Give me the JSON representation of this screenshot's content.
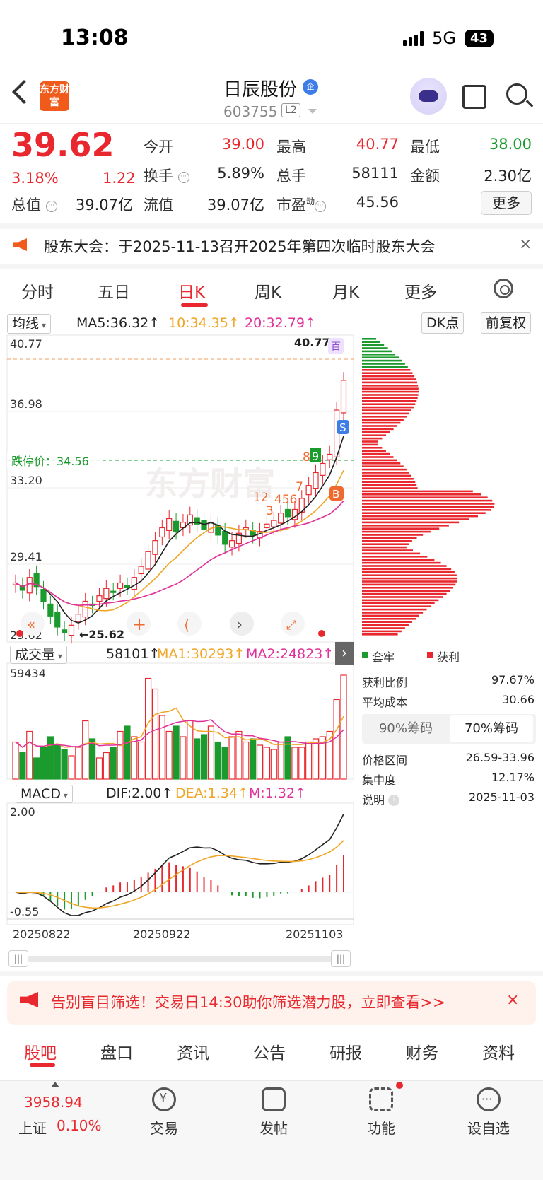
{
  "status": {
    "time": "13:08",
    "network": "5G",
    "battery": "43"
  },
  "header": {
    "logo": "东方财富",
    "name": "日辰股份",
    "badge": "企",
    "code": "603755",
    "level": "L2"
  },
  "quote": {
    "price": "39.62",
    "pct": "3.18%",
    "change": "1.22",
    "open_label": "今开",
    "open": "39.00",
    "high_label": "最高",
    "high": "40.77",
    "low_label": "最低",
    "low": "38.00",
    "turnover_label": "换手",
    "turnover": "5.89%",
    "volume_label": "总手",
    "volume": "58111",
    "amount_label": "金额",
    "amount": "2.30亿",
    "mcap_label": "总值",
    "mcap": "39.07亿",
    "float_label": "流值",
    "float": "39.07亿",
    "pe_label": "市盈",
    "pe_sup": "动",
    "pe": "45.56",
    "more": "更多"
  },
  "notice": {
    "text": "股东大会：于2025-11-13召开2025年第四次临时股东大会",
    "close": "×"
  },
  "tabs": [
    "分时",
    "五日",
    "日K",
    "周K",
    "月K",
    "更多"
  ],
  "ma": {
    "selector": "均线",
    "ma5": "MA5:36.32↑",
    "ma10": "10:34.35↑",
    "ma20": "20:32.79↑",
    "dk": "DK点",
    "adjust": "前复权"
  },
  "kline": {
    "y_labels": [
      "40.77",
      "36.98",
      "33.20",
      "29.41",
      "25.62"
    ],
    "high_mark": "40.77",
    "low_mark": "←25.62",
    "limit_down": "跌停价：34.56",
    "watermark": "东方财富",
    "markers": [
      "12",
      "3",
      "456",
      "7",
      "8",
      "9",
      "S",
      "B",
      "百"
    ]
  },
  "volume": {
    "selector": "成交量",
    "value": "58101↑",
    "ma1": "MA1:30293↑",
    "ma2": "MA2:24823↑",
    "max": "59434"
  },
  "macd": {
    "selector": "MACD",
    "dif": "DIF:2.00↑",
    "dea": "DEA:1.34↑",
    "m": "M:1.32↑",
    "max": "2.00",
    "min": "-0.55",
    "dates": [
      "20250822",
      "20250922",
      "20251103"
    ]
  },
  "chips": {
    "legend_trapped": "套牢",
    "legend_profit": "获利",
    "rows": [
      {
        "label": "获利比例",
        "value": "97.67%"
      },
      {
        "label": "平均成本",
        "value": "30.66"
      }
    ],
    "toggle": [
      "90%筹码",
      "70%筹码"
    ],
    "rows2": [
      {
        "label": "价格区间",
        "value": "26.59-33.96"
      },
      {
        "label": "集中度",
        "value": "12.17%"
      },
      {
        "label": "说明",
        "value": "2025-11-03"
      }
    ]
  },
  "banner": {
    "text": "告别盲目筛选！交易日14:30助你筛选潜力股，立即查看>>",
    "close": "×"
  },
  "bottom_tabs": [
    "股吧",
    "盘口",
    "资讯",
    "公告",
    "研报",
    "财务",
    "资料"
  ],
  "nav": {
    "index_value": "3958.94",
    "index_name": "上证",
    "index_pct": "0.10%",
    "trade": "交易",
    "post": "发帖",
    "func": "功能",
    "watch": "设自选"
  },
  "colors": {
    "up": "#e8282e",
    "down": "#1b9b2e",
    "ma10": "#f0a524",
    "ma20": "#e0309a",
    "accent": "#f05a1a"
  },
  "chart_data": {
    "type": "candlestick",
    "series_closes": [
      28.6,
      28.2,
      28.9,
      28.4,
      27.6,
      26.8,
      26.2,
      25.9,
      26.3,
      26.9,
      27.6,
      27.4,
      27.9,
      28.3,
      28.1,
      28.6,
      28.4,
      28.9,
      29.5,
      30.3,
      30.9,
      31.6,
      32.1,
      31.4,
      31.9,
      32.3,
      31.8,
      31.5,
      31.9,
      31.2,
      30.7,
      30.9,
      31.3,
      31.6,
      31.2,
      31.4,
      31.8,
      32.0,
      32.4,
      32.2,
      32.6,
      33.2,
      33.9,
      34.6,
      35.1,
      35.6,
      38.0,
      39.62
    ]
  }
}
